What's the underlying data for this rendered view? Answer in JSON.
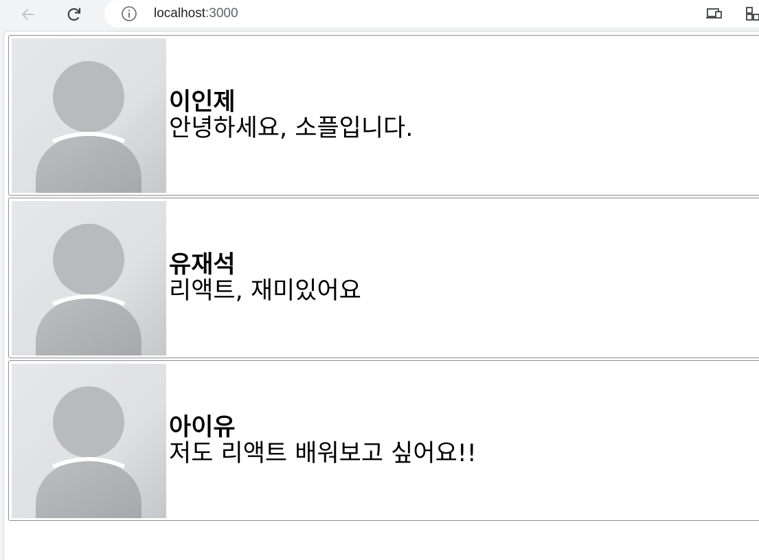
{
  "browser": {
    "url_host": "localhost",
    "url_port": ":3000"
  },
  "comments": [
    {
      "name": "이인제",
      "text": "안녕하세요, 소플입니다."
    },
    {
      "name": "유재석",
      "text": "리액트, 재미있어요"
    },
    {
      "name": "아이유",
      "text": "저도 리액트 배워보고 싶어요!!"
    }
  ],
  "colors": {
    "avatar_background": "#e4e5e7",
    "avatar_figure": "#b9babd",
    "card_border": "#8c8c8c"
  }
}
